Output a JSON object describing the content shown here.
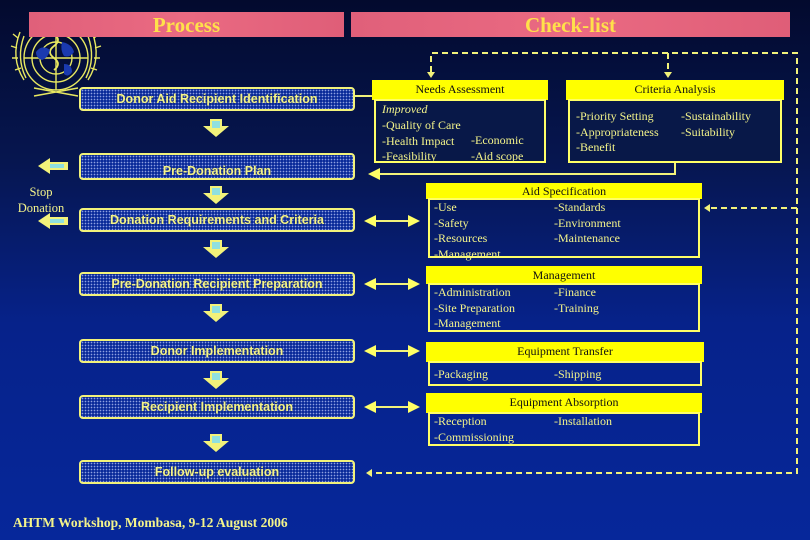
{
  "header": {
    "process_title": "Process",
    "checklist_title": "Check-list"
  },
  "emblem": {
    "name": "UN / WHO emblem"
  },
  "process_steps": [
    {
      "label": "Donor Aid Recipient Identification"
    },
    {
      "label": "Pre-Donation Plan"
    },
    {
      "label": "Donation Requirements and Criteria"
    },
    {
      "label": "Pre-Donation Recipient Preparation"
    },
    {
      "label": "Donor Implementation"
    },
    {
      "label": "Recipient Implementation"
    },
    {
      "label": "Follow-up evaluation"
    }
  ],
  "stop_donation": {
    "label_line1": "Stop",
    "label_line2": "Donation"
  },
  "checklist": {
    "needs_assessment": {
      "title": "Needs Assessment",
      "subtitle": "Improved",
      "col1": [
        "-Quality of Care",
        "-Health Impact",
        "-Feasibility"
      ],
      "col2": [
        "-Economic",
        "-Aid scope"
      ]
    },
    "criteria_analysis": {
      "title": "Criteria Analysis",
      "col1": [
        "-Priority Setting",
        "-Appropriateness",
        "-Benefit"
      ],
      "col2": [
        "-Sustainability",
        "-Suitability"
      ]
    },
    "aid_specification": {
      "title": "Aid Specification",
      "col1": [
        "-Use",
        "-Safety",
        "-Resources",
        "-Management"
      ],
      "col2": [
        "-Standards",
        "-Environment",
        "-Maintenance"
      ]
    },
    "management": {
      "title": "Management",
      "col1": [
        "-Administration",
        "-Site Preparation",
        "-Management"
      ],
      "col2": [
        "-Finance",
        "-Training"
      ]
    },
    "equipment_transfer": {
      "title": "Equipment Transfer",
      "col1": [
        "-Packaging"
      ],
      "col2": [
        "-Shipping"
      ]
    },
    "equipment_absorption": {
      "title": "Equipment Absorption",
      "col1": [
        "-Reception",
        "-Commissioning"
      ],
      "col2": [
        "-Installation"
      ]
    }
  },
  "footer": {
    "text": "AHTM Workshop, Mombasa, 9-12 August 2006"
  },
  "colors": {
    "background_top": "#030a2e",
    "background_bottom": "#06279a",
    "header_bar": "#e8687f",
    "header_text": "#ffe14a",
    "accent_yellow": "#ffff00",
    "text_yellow": "#f4f48a",
    "arrow_fill": "#8fe0e0"
  }
}
